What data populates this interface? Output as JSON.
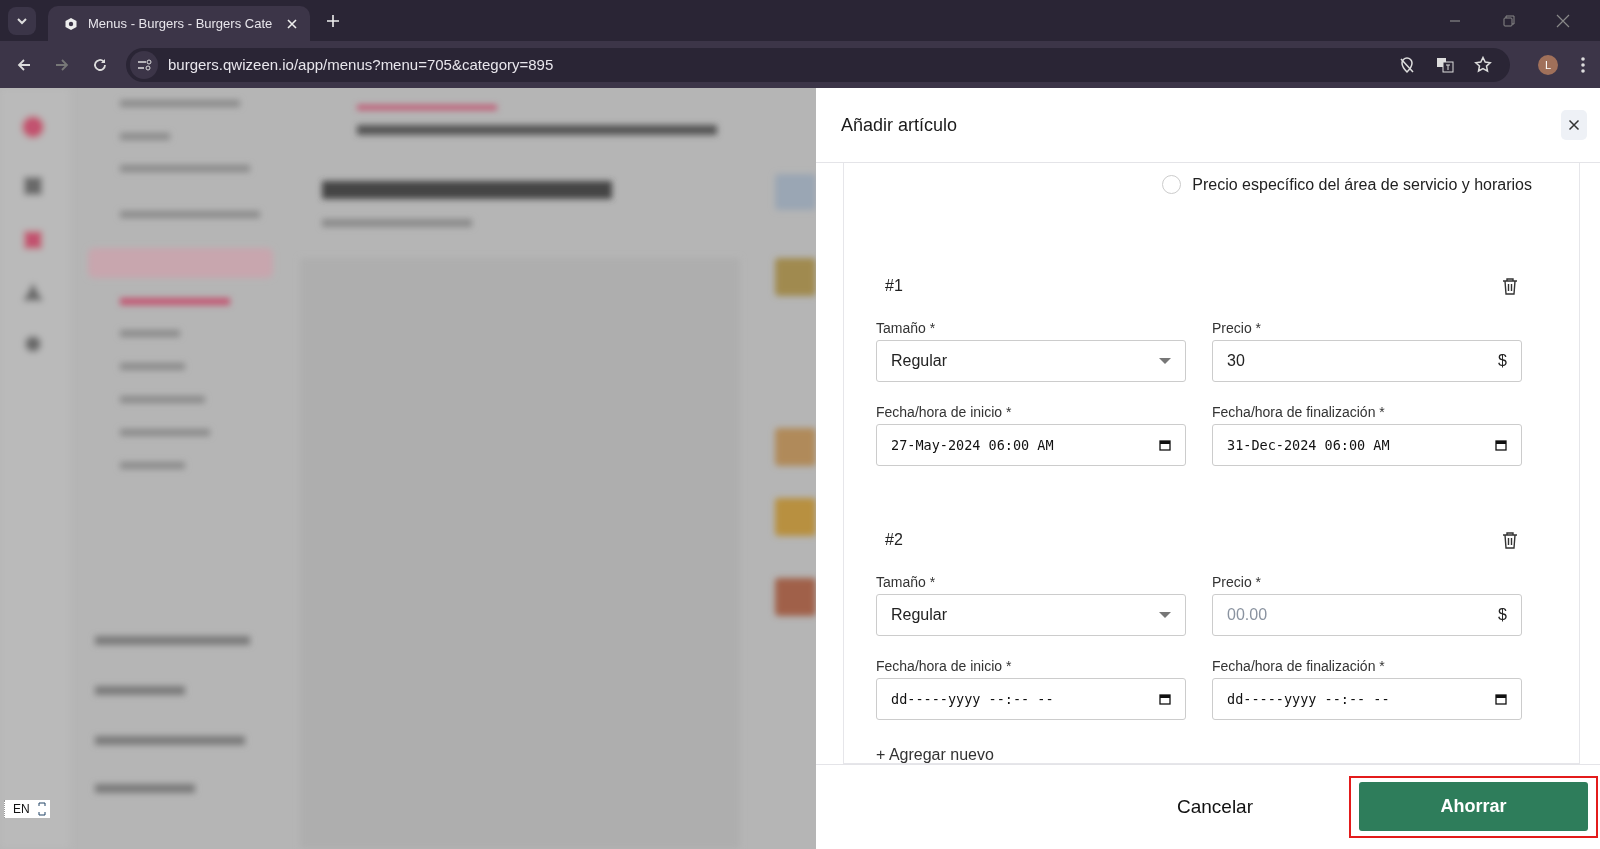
{
  "browser": {
    "tabs": [
      {
        "title": "Menus - Burgers - Burgers Cate",
        "selected": true
      }
    ],
    "url": "burgers.qwizeen.io/app/menus?menu=705&category=895",
    "profile_initial": "L"
  },
  "language_badge": {
    "label": "EN"
  },
  "dialog": {
    "title": "Añadir artículo",
    "options": [
      {
        "label": "Precio específico del área de servicio y horarios",
        "selected": false
      }
    ],
    "prices": [
      {
        "number": "#1",
        "size_label": "Tamaño *",
        "size": "Regular",
        "price_label": "Precio *",
        "price": "30",
        "currency": "$",
        "start_label": "Fecha/hora de inicio *",
        "start": "27-May-2024 06:00 AM",
        "end_label": "Fecha/hora de finalización *",
        "end": "31-Dec-2024 06:00 AM"
      },
      {
        "number": "#2",
        "size_label": "Tamaño *",
        "size": "Regular",
        "price_label": "Precio *",
        "price_placeholder": "00.00",
        "currency": "$",
        "start_label": "Fecha/hora de inicio *",
        "start_placeholder": "dd-----yyyy --:-- --",
        "end_label": "Fecha/hora de finalización *",
        "end_placeholder": "dd-----yyyy --:-- --"
      }
    ],
    "add_link": "+ Agregar nuevo",
    "cancel": "Cancelar",
    "save": {
      "label": "Ahorrar",
      "highlighted": true
    }
  }
}
